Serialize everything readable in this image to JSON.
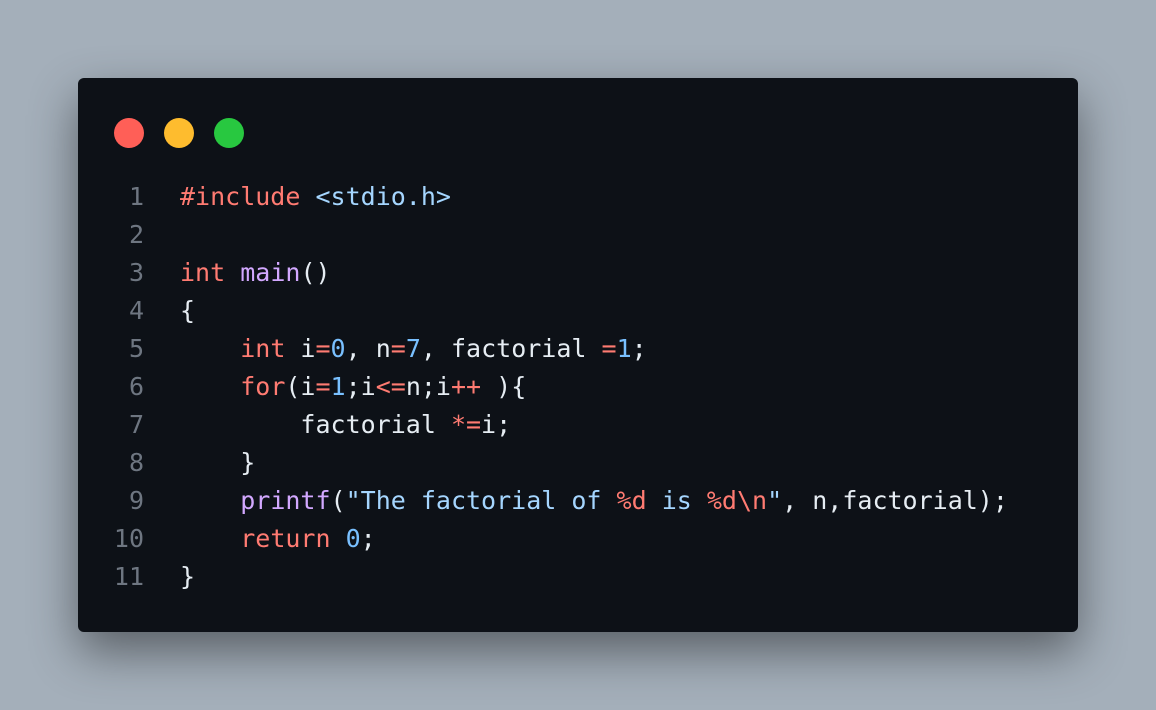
{
  "window": {
    "dots": {
      "close_color": "#ff5f57",
      "minimize_color": "#febc2e",
      "maximize_color": "#28c840"
    }
  },
  "code": {
    "lines": [
      {
        "number": "1",
        "tokens": [
          {
            "t": "#include",
            "k": "kw"
          },
          {
            "t": " ",
            "k": "p"
          },
          {
            "t": "<stdio.h>",
            "k": "inc"
          }
        ]
      },
      {
        "number": "2",
        "tokens": []
      },
      {
        "number": "3",
        "tokens": [
          {
            "t": "int",
            "k": "kw"
          },
          {
            "t": " ",
            "k": "p"
          },
          {
            "t": "main",
            "k": "fn"
          },
          {
            "t": "()",
            "k": "p"
          }
        ]
      },
      {
        "number": "4",
        "tokens": [
          {
            "t": "{",
            "k": "p"
          }
        ]
      },
      {
        "number": "5",
        "tokens": [
          {
            "t": "    ",
            "k": "p"
          },
          {
            "t": "int",
            "k": "kw"
          },
          {
            "t": " i",
            "k": "p"
          },
          {
            "t": "=",
            "k": "op"
          },
          {
            "t": "0",
            "k": "num"
          },
          {
            "t": ", n",
            "k": "p"
          },
          {
            "t": "=",
            "k": "op"
          },
          {
            "t": "7",
            "k": "num"
          },
          {
            "t": ", factorial ",
            "k": "p"
          },
          {
            "t": "=",
            "k": "op"
          },
          {
            "t": "1",
            "k": "num"
          },
          {
            "t": ";",
            "k": "p"
          }
        ]
      },
      {
        "number": "6",
        "tokens": [
          {
            "t": "    ",
            "k": "p"
          },
          {
            "t": "for",
            "k": "kw"
          },
          {
            "t": "(i",
            "k": "p"
          },
          {
            "t": "=",
            "k": "op"
          },
          {
            "t": "1",
            "k": "num"
          },
          {
            "t": ";i",
            "k": "p"
          },
          {
            "t": "<=",
            "k": "op"
          },
          {
            "t": "n;i",
            "k": "p"
          },
          {
            "t": "++",
            "k": "op"
          },
          {
            "t": " ){",
            "k": "p"
          }
        ]
      },
      {
        "number": "7",
        "tokens": [
          {
            "t": "        factorial ",
            "k": "p"
          },
          {
            "t": "*=",
            "k": "op"
          },
          {
            "t": "i;",
            "k": "p"
          }
        ]
      },
      {
        "number": "8",
        "tokens": [
          {
            "t": "    }",
            "k": "p"
          }
        ]
      },
      {
        "number": "9",
        "tokens": [
          {
            "t": "    ",
            "k": "p"
          },
          {
            "t": "printf",
            "k": "fn"
          },
          {
            "t": "(",
            "k": "p"
          },
          {
            "t": "\"The factorial of ",
            "k": "str"
          },
          {
            "t": "%d",
            "k": "fmt"
          },
          {
            "t": " is ",
            "k": "str"
          },
          {
            "t": "%d\\n",
            "k": "fmt"
          },
          {
            "t": "\"",
            "k": "str"
          },
          {
            "t": ", n,factorial);",
            "k": "p"
          }
        ]
      },
      {
        "number": "10",
        "tokens": [
          {
            "t": "    ",
            "k": "p"
          },
          {
            "t": "return",
            "k": "kw"
          },
          {
            "t": " ",
            "k": "p"
          },
          {
            "t": "0",
            "k": "num"
          },
          {
            "t": ";",
            "k": "p"
          }
        ]
      },
      {
        "number": "11",
        "tokens": [
          {
            "t": "}",
            "k": "p"
          }
        ]
      }
    ]
  }
}
